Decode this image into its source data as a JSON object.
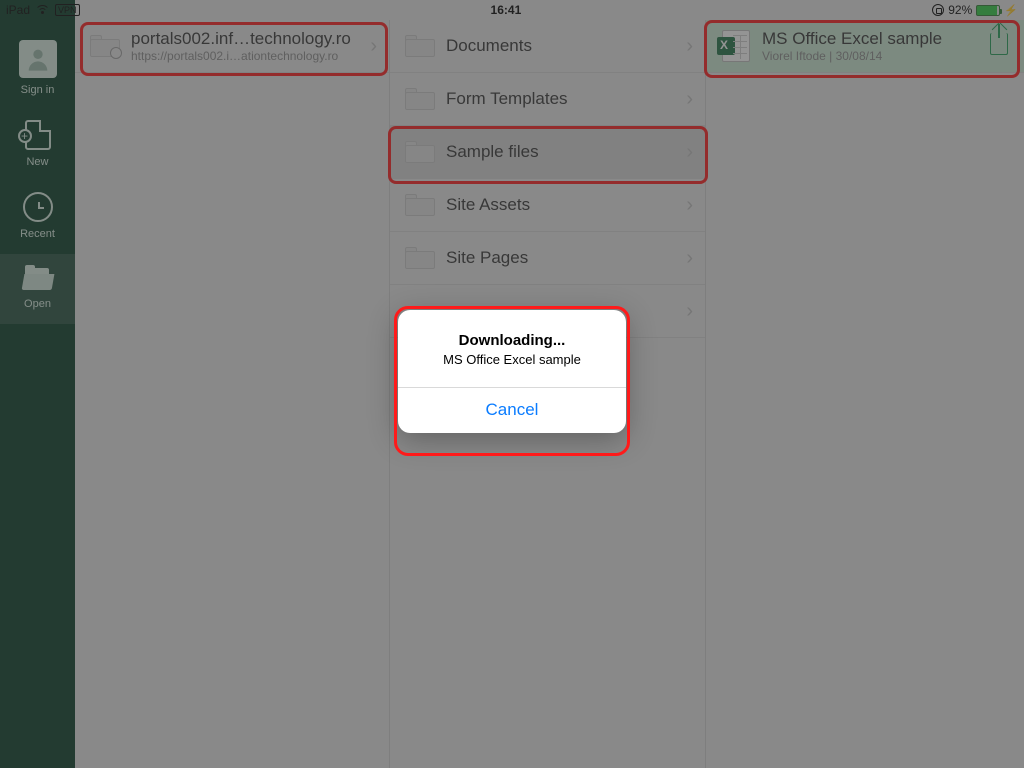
{
  "status": {
    "device": "iPad",
    "vpn": "VPN",
    "time": "16:41",
    "battery_pct": "92%"
  },
  "sidebar": {
    "signin": "Sign in",
    "new": "New",
    "recent": "Recent",
    "open": "Open"
  },
  "col1": {
    "site": {
      "title": "portals002.inf…technology.ro",
      "sub": "https://portals002.i…ationtechnology.ro"
    }
  },
  "col2": {
    "folders": [
      {
        "label": "Documents"
      },
      {
        "label": "Form Templates"
      },
      {
        "label": "Sample files"
      },
      {
        "label": "Site Assets"
      },
      {
        "label": "Site Pages"
      },
      {
        "label": ""
      }
    ],
    "selected_index": 2
  },
  "col3": {
    "file": {
      "title": "MS Office Excel sample",
      "sub": "Viorel Iftode | 30/08/14"
    }
  },
  "alert": {
    "title": "Downloading...",
    "message": "MS Office Excel sample",
    "cancel": "Cancel"
  }
}
